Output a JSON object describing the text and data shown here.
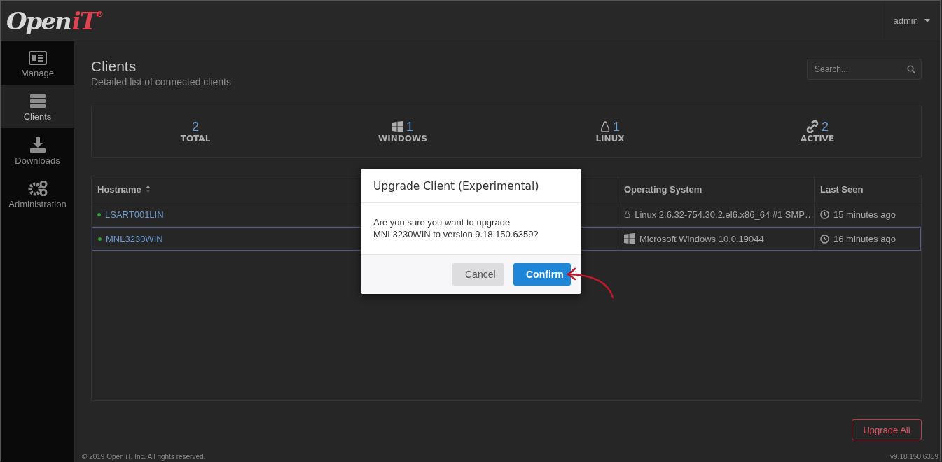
{
  "logo": {
    "word": "Open",
    "mark": "iT",
    "registered": "®"
  },
  "user_menu": {
    "label": "admin"
  },
  "sidebar": {
    "items": [
      {
        "label": "Manage",
        "kind": "manage",
        "selected": false
      },
      {
        "label": "Clients",
        "kind": "clients",
        "selected": true
      },
      {
        "label": "Downloads",
        "kind": "downloads",
        "selected": false
      },
      {
        "label": "Administration",
        "kind": "administration",
        "selected": false
      }
    ]
  },
  "page": {
    "title": "Clients",
    "subtitle": "Detailed list of connected clients"
  },
  "search": {
    "placeholder": "Search..."
  },
  "stats": [
    {
      "kind": "total",
      "count": "2",
      "label": "TOTAL"
    },
    {
      "kind": "windows",
      "count": "1",
      "label": "WINDOWS"
    },
    {
      "kind": "linux",
      "count": "1",
      "label": "LINUX"
    },
    {
      "kind": "active",
      "count": "2",
      "label": "ACTIVE"
    }
  ],
  "table": {
    "columns": [
      "Hostname",
      "Operating System",
      "Last Seen"
    ],
    "rows": [
      {
        "hostname": "LSART001LIN",
        "color": "#2f9a3a",
        "kind": "linux",
        "os": "Linux 2.6.32-754.30.2.el6.x86_64 #1 SMP…",
        "last_seen": "15 minutes ago",
        "selected": false
      },
      {
        "hostname": "MNL3230WIN",
        "color": "#2f9a3a",
        "kind": "windows",
        "os": "Microsoft Windows 10.0.19044",
        "last_seen": "16 minutes ago",
        "selected": true
      }
    ]
  },
  "upgrade_all": {
    "label": "Upgrade All"
  },
  "footer": {
    "copyright": "© 2019 Open iT, Inc. All rights reserved.",
    "version": "v9.18.150.6359"
  },
  "dialog": {
    "title": "Upgrade Client (Experimental)",
    "message": "Are you sure you want to upgrade MNL3230WIN to version 9.18.150.6359?",
    "buttons": [
      {
        "label": "Cancel",
        "kind": "secondary"
      },
      {
        "label": "Confirm",
        "kind": "primary"
      }
    ]
  }
}
